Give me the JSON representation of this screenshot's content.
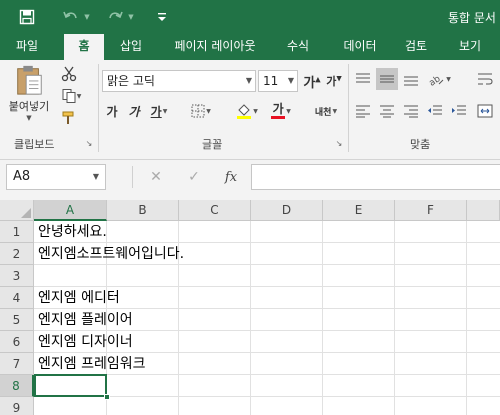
{
  "title_bar": {
    "doc_title": "통합 문서",
    "save_icon": "save-icon",
    "undo_icon": "undo-icon",
    "redo_icon": "redo-icon",
    "customize_icon": "customize-qat-icon"
  },
  "tabs": [
    "파일",
    "홈",
    "삽입",
    "페이지 레이아웃",
    "수식",
    "데이터",
    "검토",
    "보기"
  ],
  "active_tab": "홈",
  "ribbon": {
    "clipboard": {
      "paste_label": "붙여넣기",
      "group_label": "클립보드"
    },
    "font": {
      "font_name": "맑은 고딕",
      "font_size": "11",
      "bold_label": "가",
      "italic_label": "가",
      "underline_label": "가",
      "font_color_label": "가",
      "phonetic_label": "내천",
      "group_label": "글꼴"
    },
    "alignment": {
      "group_label": "맞춤"
    }
  },
  "formula_bar": {
    "name_box": "A8",
    "cancel_icon": "✕",
    "enter_icon": "✓",
    "fx_label": "fx",
    "formula_value": ""
  },
  "sheet": {
    "columns": [
      "A",
      "B",
      "C",
      "D",
      "E",
      "F"
    ],
    "rows": [
      "1",
      "2",
      "3",
      "4",
      "5",
      "6",
      "7",
      "8",
      "9"
    ],
    "selected_column": "A",
    "selected_row": "8",
    "cells": {
      "A1": "안녕하세요.",
      "A2": "엔지엠소프트웨어입니다.",
      "A3": "",
      "A4": "엔지엠 에디터",
      "A5": "엔지엠 플레이어",
      "A6": "엔지엠 디자이너",
      "A7": "엔지엠 프레임워크",
      "A8": ""
    }
  },
  "colors": {
    "accent": "#217346",
    "ribbon_bg": "#f3f3f3",
    "header_bg": "#e6e6e6",
    "font_color_bar": "#e81123",
    "fill_color_bar": "#ffff00"
  }
}
